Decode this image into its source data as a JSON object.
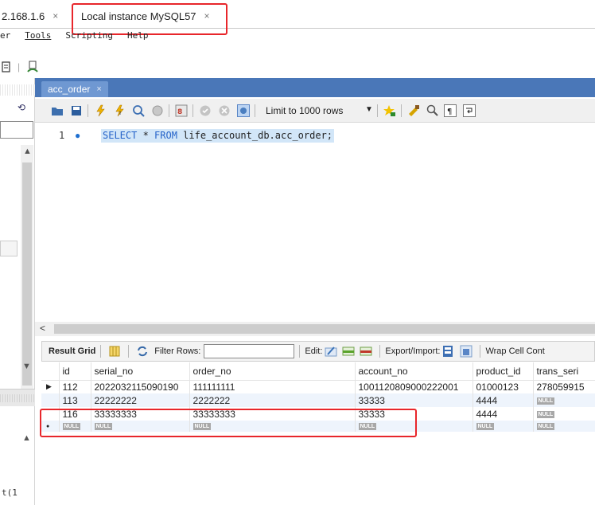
{
  "connection_tabs": [
    {
      "label": "2.168.1.6",
      "close": "×"
    },
    {
      "label": "Local instance MySQL57",
      "close": "×"
    }
  ],
  "menu": [
    "er",
    "Tools",
    "Scripting",
    "Help"
  ],
  "editor_tab": {
    "label": "acc_order",
    "close": "×"
  },
  "toolbar": {
    "limit_label": "Limit to 1000 rows"
  },
  "editor": {
    "line_number": "1",
    "sql_tokens": [
      {
        "text": "SELECT",
        "kind": "keyword"
      },
      {
        "text": " * ",
        "kind": "plain"
      },
      {
        "text": "FROM",
        "kind": "keyword"
      },
      {
        "text": " life_account_db.acc_order;",
        "kind": "plain"
      }
    ]
  },
  "result_toolbar": {
    "result_grid": "Result Grid",
    "filter_rows": "Filter Rows:",
    "edit": "Edit:",
    "export_import": "Export/Import:",
    "wrap_cell": "Wrap Cell Cont"
  },
  "grid": {
    "columns": [
      "id",
      "serial_no",
      "order_no",
      "account_no",
      "product_id",
      "trans_seri"
    ],
    "rows": [
      {
        "marker": "▶",
        "cells": [
          "112",
          "2022032115090190",
          "111111111",
          "1001120809000222001",
          "01000123",
          "278059915"
        ]
      },
      {
        "marker": "",
        "cells": [
          "113",
          "22222222",
          "2222222",
          "33333",
          "4444",
          "NULL"
        ]
      },
      {
        "marker": "",
        "cells": [
          "116",
          "33333333",
          "33333333",
          "33333",
          "4444",
          "NULL"
        ]
      },
      {
        "marker": "●",
        "cells": [
          "NULL",
          "NULL",
          "NULL",
          "NULL",
          "NULL",
          "NULL"
        ]
      }
    ]
  },
  "left_panel": {
    "bottom_text": "t(1"
  },
  "colors": {
    "highlight": "#e8262b",
    "tab_strip": "#4a77b8",
    "keyword": "#2563c9",
    "selection": "#d2e6f8"
  }
}
